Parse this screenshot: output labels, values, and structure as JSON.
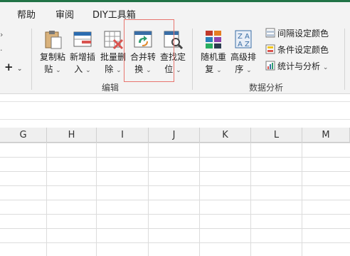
{
  "tabs": {
    "help": "帮助",
    "review": "审阅",
    "diy": "DIY工具箱"
  },
  "ribbon": {
    "left_plus": "+",
    "edit_group": {
      "label": "编辑",
      "buttons": [
        {
          "line1": "复制粘",
          "line2": "贴"
        },
        {
          "line1": "新增插",
          "line2": "入"
        },
        {
          "line1": "批量删",
          "line2": "除"
        },
        {
          "line1": "合并转",
          "line2": "换"
        },
        {
          "line1": "查找定",
          "line2": "位"
        }
      ]
    },
    "data_group": {
      "label": "数据分析",
      "buttons": [
        {
          "line1": "随机重",
          "line2": "复"
        },
        {
          "line1": "高级排",
          "line2": "序"
        }
      ],
      "small_buttons": [
        {
          "label": "间隔设定颜色"
        },
        {
          "label": "条件设定颜色"
        },
        {
          "label": "统计与分析"
        }
      ]
    },
    "caret": "⌄"
  },
  "sheet": {
    "columns": [
      "G",
      "H",
      "I",
      "J",
      "K",
      "L",
      "M"
    ]
  },
  "colors": {
    "accent": "#217346",
    "highlight": "#e8766f"
  }
}
